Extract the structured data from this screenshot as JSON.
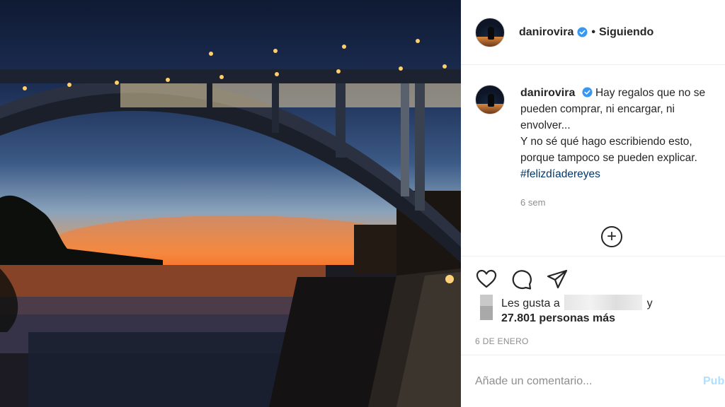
{
  "post": {
    "username": "danirovira",
    "follow_status": "Siguiendo",
    "caption_lines": [
      "Hay regalos que no se",
      "pueden comprar, ni encargar, ni",
      "envolver...",
      "Y no sé qué hago escribiendo esto,",
      "porque tampoco se pueden explicar."
    ],
    "hashtag": "#felizdíadereyes",
    "time_ago": "6 sem",
    "likes_prefix": "Les gusta a",
    "likes_and": "y",
    "likes_count": "27.801 personas más",
    "date": "6 DE ENERO",
    "comment_placeholder": "Añade un comentario...",
    "publish_label": "Publicar"
  },
  "icons": {
    "verified": "verified-badge-icon",
    "like": "heart-icon",
    "comment": "comment-bubble-icon",
    "share": "paper-plane-icon",
    "more": "plus-circle-icon"
  },
  "colors": {
    "verified": "#3897f0",
    "hashtag": "#00376b",
    "muted": "#8e8e8e",
    "publish": "#b2dffc"
  }
}
